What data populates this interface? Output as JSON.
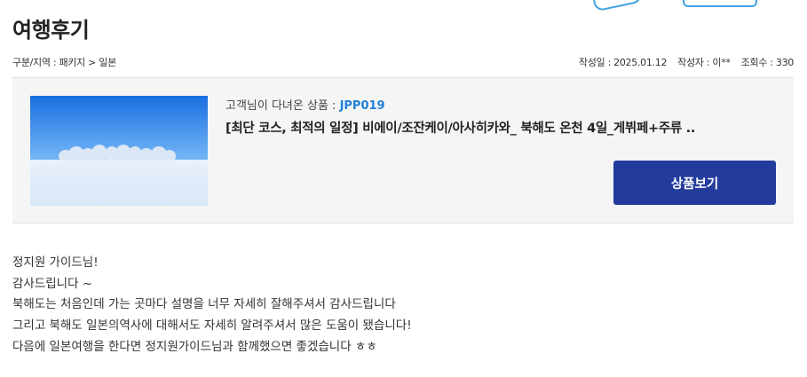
{
  "page": {
    "title": "여행후기"
  },
  "meta": {
    "category": "구분/지역 : 패키지 > 일본",
    "date_label": "작성일 : 2025.01.12",
    "author_label": "작성자 : 이**",
    "views_label": "조회수 : 330"
  },
  "product": {
    "label_prefix": "고객님이 다녀온 상품 : ",
    "code": "JPP019",
    "name": "[최단 코스, 최적의 일정] 비에이/조잔케이/아사히카와_ 북해도 온천 4일_게뷔페+주류 ..",
    "button_label": "상품보기"
  },
  "review": {
    "lines": [
      "정지원 가이드님!",
      "감사드립니다 ~",
      "북해도는 처음인데 가는 곳마다 설명을 너무 자세히 잘해주셔서 감사드립니다",
      "그리고 북해도 일본의역사에 대해서도 자세히 알려주셔서 많은 도움이 됐습니다!",
      "다음에 일본여행을 한다면 정지원가이드님과 함께했으면 좋겠습니다 ㅎㅎ"
    ]
  },
  "colors": {
    "button_bg": "#233c9c",
    "code_blue": "#1f7fd6",
    "box_bg": "#f5f5f5"
  }
}
